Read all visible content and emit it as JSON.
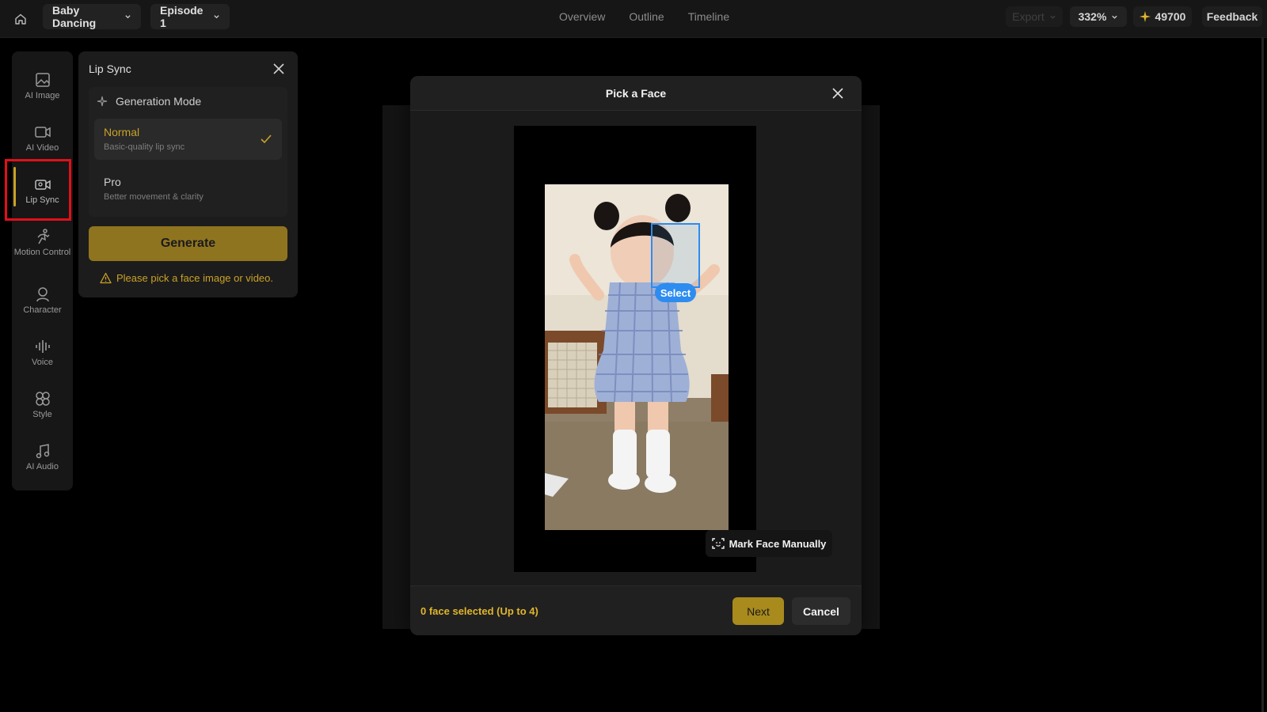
{
  "topbar": {
    "project": "Baby Dancing",
    "episode": "Episode 1",
    "tabs": [
      "Overview",
      "Outline",
      "Timeline"
    ],
    "export_label": "Export",
    "zoom": "332%",
    "credits": "49700",
    "feedback_label": "Feedback"
  },
  "rail": {
    "items": [
      {
        "label": "AI Image",
        "icon": "image-icon"
      },
      {
        "label": "AI Video",
        "icon": "video-icon"
      },
      {
        "label": "Lip Sync",
        "icon": "lip-sync-icon"
      },
      {
        "label": "Motion Control",
        "icon": "motion-icon"
      },
      {
        "label": "Character",
        "icon": "character-icon"
      },
      {
        "label": "Voice",
        "icon": "voice-icon"
      },
      {
        "label": "Style",
        "icon": "style-icon"
      },
      {
        "label": "AI Audio",
        "icon": "audio-icon"
      }
    ],
    "active": "Lip Sync"
  },
  "panel": {
    "title": "Lip Sync",
    "mode_header": "Generation Mode",
    "modes": [
      {
        "name": "Normal",
        "desc": "Basic-quality lip sync",
        "selected": true
      },
      {
        "name": "Pro",
        "desc": "Better movement & clarity",
        "selected": false
      }
    ],
    "generate_label": "Generate",
    "warning": "Please pick a face image or video."
  },
  "modal": {
    "title": "Pick a Face",
    "select_label": "Select",
    "mark_face_label": "Mark Face Manually",
    "face_count": "0 face selected (Up to 4)",
    "next_label": "Next",
    "cancel_label": "Cancel"
  },
  "colors": {
    "accent": "#c9a227",
    "face_box": "#2d8cf0",
    "highlight": "#e0101a"
  }
}
